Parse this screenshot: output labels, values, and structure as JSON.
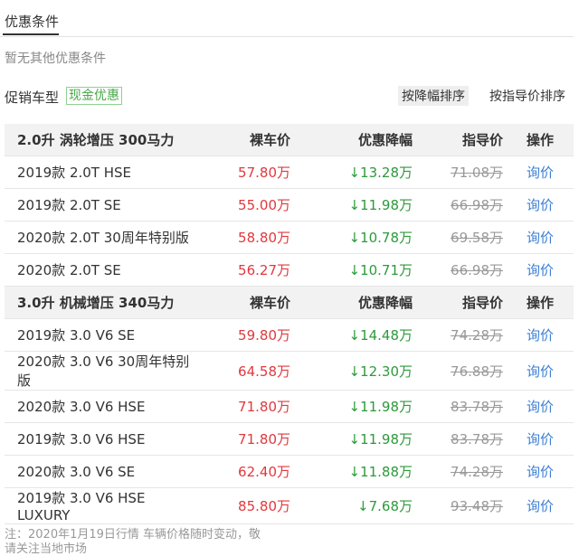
{
  "tab": {
    "title": "优惠条件"
  },
  "no_conditions": "暂无其他优惠条件",
  "promo": {
    "label": "促销车型",
    "cash_tag": "现金优惠"
  },
  "sort": {
    "by_discount": "按降幅排序",
    "by_msrp": "按指导价排序"
  },
  "sections": [
    {
      "header": {
        "name": "2.0升 涡轮增压 300马力",
        "price": "裸车价",
        "discount": "优惠降幅",
        "msrp": "指导价",
        "op": "操作"
      },
      "rows": [
        {
          "name": "2019款 2.0T HSE",
          "price": "57.80万",
          "discount": "↓13.28万",
          "msrp": "71.08万",
          "op": "询价"
        },
        {
          "name": "2019款 2.0T SE",
          "price": "55.00万",
          "discount": "↓11.98万",
          "msrp": "66.98万",
          "op": "询价"
        },
        {
          "name": "2020款 2.0T 30周年特别版",
          "price": "58.80万",
          "discount": "↓10.78万",
          "msrp": "69.58万",
          "op": "询价"
        },
        {
          "name": "2020款 2.0T SE",
          "price": "56.27万",
          "discount": "↓10.71万",
          "msrp": "66.98万",
          "op": "询价"
        }
      ]
    },
    {
      "header": {
        "name": "3.0升 机械增压 340马力",
        "price": "裸车价",
        "discount": "优惠降幅",
        "msrp": "指导价",
        "op": "操作"
      },
      "rows": [
        {
          "name": "2019款 3.0 V6 SE",
          "price": "59.80万",
          "discount": "↓14.48万",
          "msrp": "74.28万",
          "op": "询价"
        },
        {
          "name": "2020款 3.0 V6 30周年特别版",
          "price": "64.58万",
          "discount": "↓12.30万",
          "msrp": "76.88万",
          "op": "询价"
        },
        {
          "name": "2020款 3.0 V6 HSE",
          "price": "71.80万",
          "discount": "↓11.98万",
          "msrp": "83.78万",
          "op": "询价"
        },
        {
          "name": "2019款 3.0 V6 HSE",
          "price": "71.80万",
          "discount": "↓11.98万",
          "msrp": "83.78万",
          "op": "询价"
        },
        {
          "name": "2020款 3.0 V6 SE",
          "price": "62.40万",
          "discount": "↓11.88万",
          "msrp": "74.28万",
          "op": "询价"
        },
        {
          "name": "2019款 3.0 V6 HSE LUXURY",
          "price": "85.80万",
          "discount": "↓7.68万",
          "msrp": "93.48万",
          "op": "询价"
        }
      ]
    }
  ],
  "note": {
    "line1": "注：2020年1月19日行情 车辆价格随时变动，敬",
    "line2": "请关注当地市场"
  }
}
